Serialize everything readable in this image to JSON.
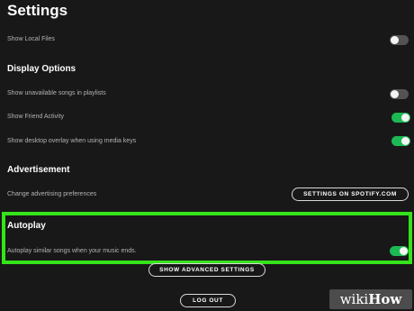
{
  "page": {
    "title": "Settings"
  },
  "local_files": {
    "label": "Show Local Files",
    "enabled": false
  },
  "display_options": {
    "heading": "Display Options",
    "items": [
      {
        "label": "Show unavailable songs in playlists",
        "enabled": false
      },
      {
        "label": "Show Friend Activity",
        "enabled": true
      },
      {
        "label": "Show desktop overlay when using media keys",
        "enabled": true
      }
    ]
  },
  "advertisement": {
    "heading": "Advertisement",
    "label": "Change advertising preferences",
    "button": "SETTINGS ON SPOTIFY.COM"
  },
  "autoplay": {
    "heading": "Autoplay",
    "label": "Autoplay similar songs when your music ends.",
    "enabled": true
  },
  "footer": {
    "advanced_button": "SHOW ADVANCED SETTINGS",
    "logout_button": "LOG OUT"
  },
  "watermark": {
    "brand": "wiki",
    "suffix": "How"
  },
  "colors": {
    "background": "#181818",
    "toggle_on": "#1db954",
    "toggle_off": "#535353",
    "highlight": "#35e31b"
  }
}
